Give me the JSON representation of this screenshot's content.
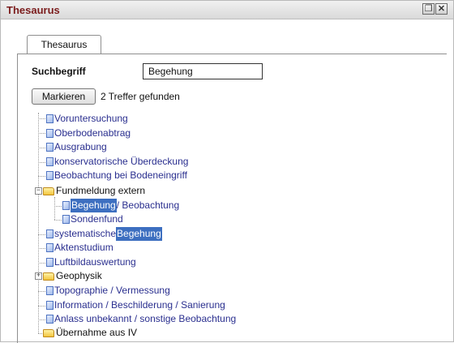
{
  "window": {
    "title": "Thesaurus",
    "restore_glyph": "❐",
    "close_glyph": "✕"
  },
  "tabs": [
    {
      "label": "Thesaurus"
    }
  ],
  "search": {
    "label": "Suchbegriff",
    "value": "Begehung"
  },
  "actions": {
    "mark_label": "Markieren",
    "result_text": "2 Treffer gefunden"
  },
  "tree": {
    "items": [
      {
        "label": "Voruntersuchung",
        "type": "doc"
      },
      {
        "label": "Oberbodenabtrag",
        "type": "doc"
      },
      {
        "label": "Ausgrabung",
        "type": "doc"
      },
      {
        "label": "konservatorische Überdeckung",
        "type": "doc"
      },
      {
        "label": "Beobachtung bei Bodeneingriff",
        "type": "doc"
      },
      {
        "label": "Fundmeldung extern",
        "type": "folder",
        "expanded": true,
        "toggle_glyph": "−",
        "children": [
          {
            "label_highlight": "Begehung",
            "label_rest": " / Beobachtung",
            "type": "doc"
          },
          {
            "label": "Sondenfund",
            "type": "doc"
          }
        ]
      },
      {
        "label_prefix": "systematische ",
        "label_highlight": "Begehung",
        "type": "doc"
      },
      {
        "label": "Aktenstudium",
        "type": "doc"
      },
      {
        "label": "Luftbildauswertung",
        "type": "doc"
      },
      {
        "label": "Geophysik",
        "type": "folder",
        "expanded": false,
        "toggle_glyph": "+"
      },
      {
        "label": "Topographie / Vermessung",
        "type": "doc"
      },
      {
        "label": "Information / Beschilderung / Sanierung",
        "type": "doc"
      },
      {
        "label": "Anlass unbekannt / sonstige Beobachtung",
        "type": "doc"
      },
      {
        "label": "Übernahme aus IV",
        "type": "folder",
        "expanded": false
      }
    ]
  },
  "colors": {
    "title": "#7b1c1c",
    "link": "#2a2f8f",
    "highlight": "#3d6fc0"
  }
}
